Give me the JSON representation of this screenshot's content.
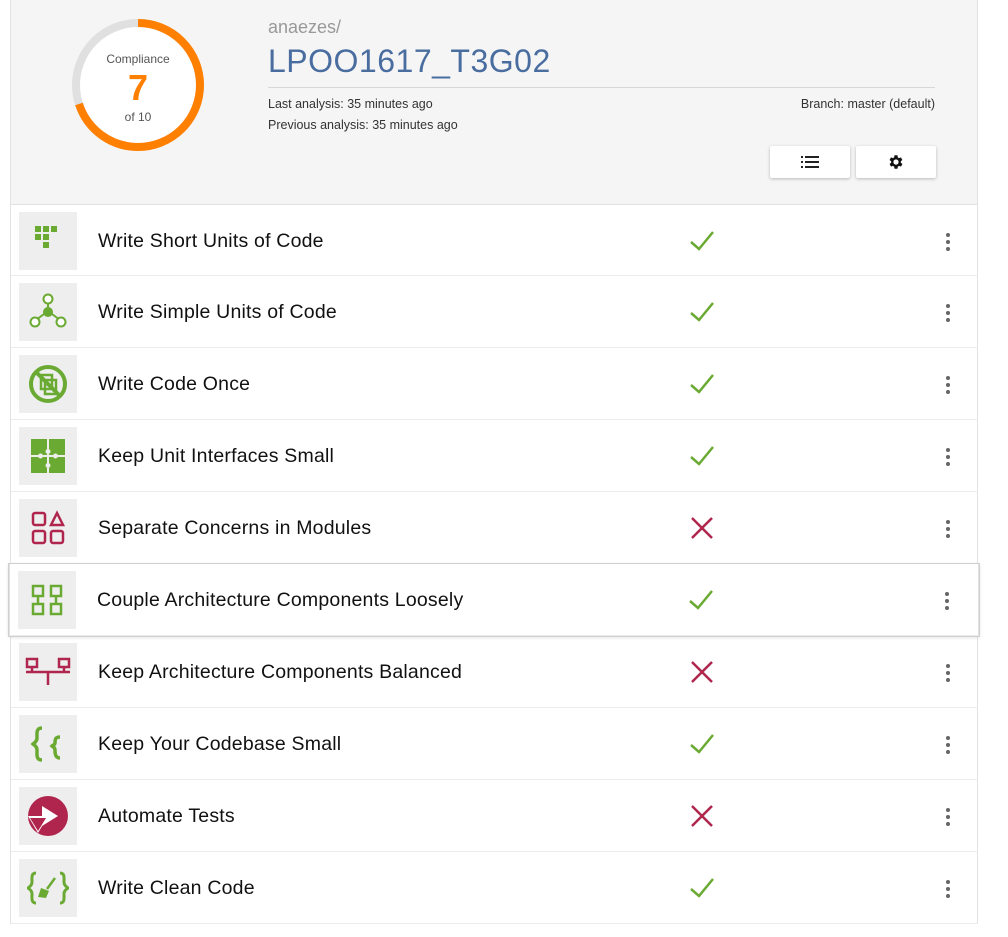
{
  "compliance": {
    "caption": "Compliance",
    "score": "7",
    "of_text": "of 10",
    "ring_fraction": 0.7,
    "ring_color": "#ff7f00",
    "track_color": "#e0e0e0"
  },
  "repository": {
    "owner": "anaezes/",
    "name": "LPOO1617_T3G02",
    "last_analysis": "Last analysis: 35 minutes ago",
    "previous_analysis": "Previous analysis: 35 minutes ago",
    "branch": "Branch: master (default)"
  },
  "toolbar": {
    "list_icon": "list-icon",
    "settings_icon": "gear-icon"
  },
  "colors": {
    "pass": "#6aaa32",
    "fail": "#b0254e",
    "title": "#4a6da0"
  },
  "guidelines": [
    {
      "label": "Write Short Units of Code",
      "icon": "short-units-icon",
      "status": "pass"
    },
    {
      "label": "Write Simple Units of Code",
      "icon": "simple-units-icon",
      "status": "pass"
    },
    {
      "label": "Write Code Once",
      "icon": "no-duplication-icon",
      "status": "pass"
    },
    {
      "label": "Keep Unit Interfaces Small",
      "icon": "puzzle-icon",
      "status": "pass"
    },
    {
      "label": "Separate Concerns in Modules",
      "icon": "modules-icon",
      "status": "fail"
    },
    {
      "label": "Couple Architecture Components Loosely",
      "icon": "components-icon",
      "status": "pass"
    },
    {
      "label": "Keep Architecture Components Balanced",
      "icon": "balance-icon",
      "status": "fail"
    },
    {
      "label": "Keep Your Codebase Small",
      "icon": "braces-icon",
      "status": "pass"
    },
    {
      "label": "Automate Tests",
      "icon": "play-test-icon",
      "status": "fail"
    },
    {
      "label": "Write Clean Code",
      "icon": "clean-code-icon",
      "status": "pass"
    }
  ]
}
